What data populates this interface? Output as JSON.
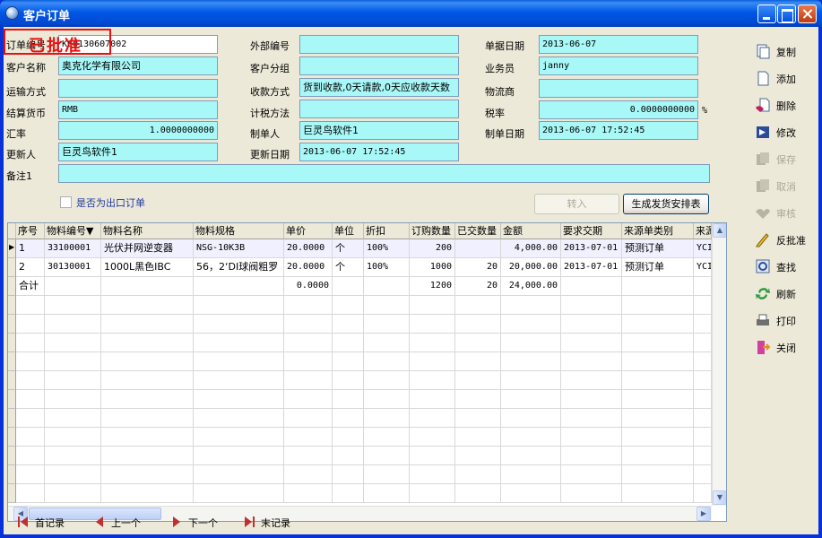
{
  "window": {
    "title": "客户订单"
  },
  "stamp": "已批准",
  "form": {
    "order_no": {
      "label": "订单编号",
      "value": "KC0130607002"
    },
    "customer_name": {
      "label": "客户名称",
      "value": "奥克化学有限公司"
    },
    "shipping": {
      "label": "运输方式",
      "value": ""
    },
    "currency": {
      "label": "结算货币",
      "value": "RMB"
    },
    "exchange_rate": {
      "label": "汇率",
      "value": "1.0000000000"
    },
    "updated_by": {
      "label": "更新人",
      "value": "巨灵鸟软件1"
    },
    "remark1": {
      "label": "备注1",
      "value": ""
    },
    "external_no": {
      "label": "外部编号",
      "value": ""
    },
    "customer_group": {
      "label": "客户分组",
      "value": ""
    },
    "payment_terms": {
      "label": "收款方式",
      "value": "货到收款,0天请款,0天应收款天数"
    },
    "tax_method": {
      "label": "计税方法",
      "value": ""
    },
    "created_by": {
      "label": "制单人",
      "value": "巨灵鸟软件1"
    },
    "updated_date": {
      "label": "更新日期",
      "value": "2013-06-07 17:52:45"
    },
    "doc_date": {
      "label": "单据日期",
      "value": "2013-06-07"
    },
    "salesperson": {
      "label": "业务员",
      "value": "janny"
    },
    "logistics": {
      "label": "物流商",
      "value": ""
    },
    "tax_rate": {
      "label": "税率",
      "value": "0.0000000000",
      "unit": "%"
    },
    "created_date": {
      "label": "制单日期",
      "value": "2013-06-07 17:52:45"
    },
    "export_checkbox": {
      "label": "是否为出口订单",
      "checked": false
    }
  },
  "buttons": {
    "transfer_in": "转入",
    "generate_schedule": "生成发货安排表"
  },
  "grid": {
    "columns": [
      "序号",
      "物料编号▼",
      "物料名称",
      "物料规格",
      "单价",
      "单位",
      "折扣",
      "订购数量",
      "已交数量",
      "金额",
      "要求交期",
      "来源单类别",
      "来源"
    ],
    "rows": [
      [
        "1",
        "33100001",
        "光伏并网逆变器",
        "NSG-10K3B",
        "20.0000",
        "个",
        "100%",
        "200",
        "",
        "4,000.00",
        "2013-07-01",
        "预测订单",
        "YCI"
      ],
      [
        "2",
        "30130001",
        "1000L黑色IBC",
        "56，2‘DI球阀粗罗",
        "20.0000",
        "个",
        "100%",
        "1000",
        "20",
        "20,000.00",
        "2013-07-01",
        "预测订单",
        "YCI"
      ],
      [
        "合计",
        "",
        "",
        "",
        "0.0000",
        "",
        "",
        "1200",
        "20",
        "24,000.00",
        "",
        "",
        ""
      ]
    ]
  },
  "toolbar": [
    {
      "label": "复制",
      "icon": "copy-icon",
      "enabled": true
    },
    {
      "label": "添加",
      "icon": "add-icon",
      "enabled": true
    },
    {
      "label": "删除",
      "icon": "delete-icon",
      "enabled": true
    },
    {
      "label": "修改",
      "icon": "edit-icon",
      "enabled": true
    },
    {
      "label": "保存",
      "icon": "save-icon",
      "enabled": false
    },
    {
      "label": "取消",
      "icon": "cancel-icon",
      "enabled": false
    },
    {
      "label": "审核",
      "icon": "approve-icon",
      "enabled": false
    },
    {
      "label": "反批准",
      "icon": "unapprove-icon",
      "enabled": true
    },
    {
      "label": "查找",
      "icon": "search-icon",
      "enabled": true
    },
    {
      "label": "刷新",
      "icon": "refresh-icon",
      "enabled": true
    },
    {
      "label": "打印",
      "icon": "print-icon",
      "enabled": true
    },
    {
      "label": "关闭",
      "icon": "close-icon",
      "enabled": true
    }
  ],
  "nav": {
    "first": "首记录",
    "prev": "上一个",
    "next": "下一个",
    "last": "末记录"
  }
}
